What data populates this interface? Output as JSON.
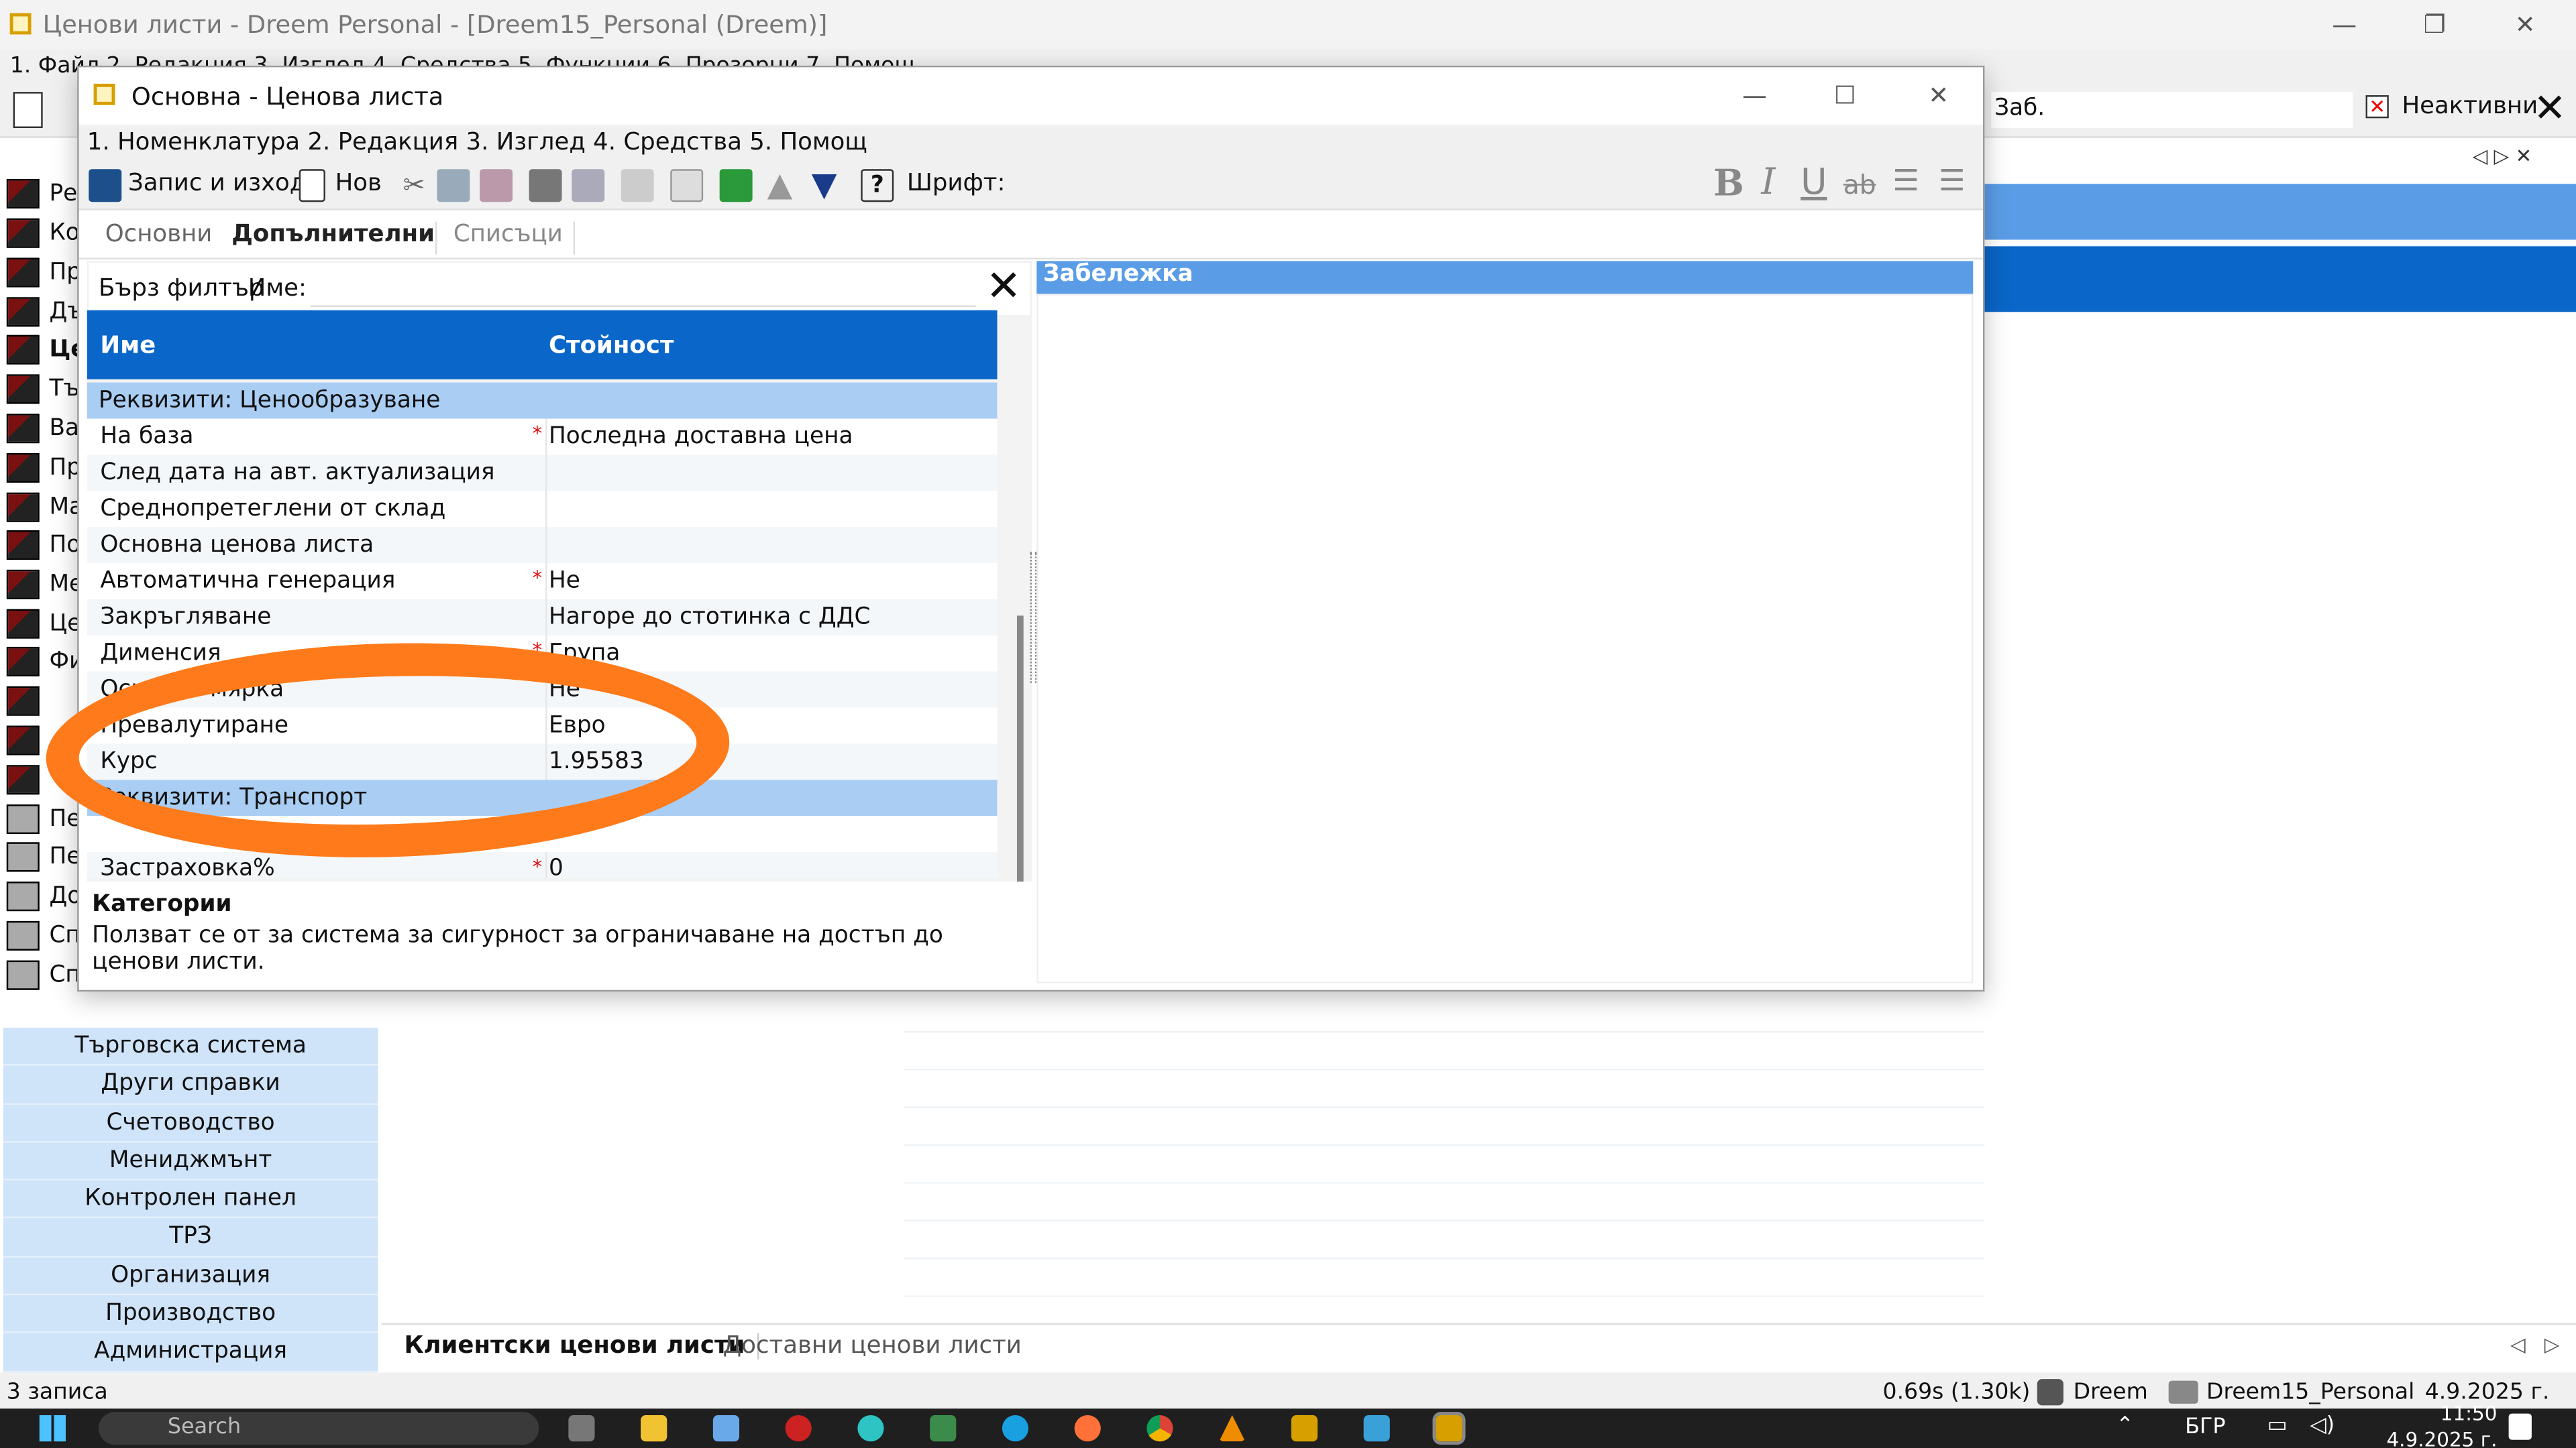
{
  "main_window": {
    "title": "Ценови листи - Dreem Personal - [Dreem15_Personal (Dreem)]",
    "menu": "1. Файл 2. Редакция 3. Изглед 4. Средства 5. Функции 6. Прозорци 7. Помощ",
    "search_label": "Заб.",
    "inactive_label": "Неактивни"
  },
  "nav_items": [
    "Ре",
    "Ко",
    "Пр",
    "Дъ",
    "Це",
    "Тъ",
    "Ва",
    "Пр",
    "Ма",
    "По",
    "Ме",
    "Це",
    "Фи",
    "",
    "",
    "",
    "Пе",
    "Пе",
    "До",
    "Сп",
    "Сп"
  ],
  "nav_groups": [
    "Търговска система",
    "Други справки",
    "Счетоводство",
    "Мениджмънт",
    "Контролен панел",
    "ТРЗ",
    "Организация",
    "Производство",
    "Администрация"
  ],
  "bottom_tabs": [
    "Клиентски ценови листи",
    "Доставни ценови листи"
  ],
  "status": {
    "records": "3 записа",
    "timing": "0.69s (1.30k)",
    "user": "Dreem",
    "database": "Dreem15_Personal",
    "date": "4.9.2025 г."
  },
  "taskbar": {
    "search": "Search",
    "language": "БГР",
    "clock_time": "11:50",
    "clock_date": "4.9.2025 г."
  },
  "dialog": {
    "title": "Основна - Ценова листа",
    "menu": "1. Номенклатура 2. Редакция 3. Изглед 4. Средства 5. Помощ",
    "toolbar": {
      "save_exit": "Запис и изход",
      "new": "Нов",
      "font_label": "Шрифт:"
    },
    "tabs": [
      "Основни",
      "Допълнителни",
      "Списъци"
    ],
    "filter": {
      "label": "Бърз филтър",
      "name_label": "Име:"
    },
    "grid": {
      "col_name": "Име",
      "col_value": "Стойност"
    },
    "group1": "Реквизити: Ценообразуване",
    "rows": [
      {
        "name": "На база",
        "value": "Последна доставна цена",
        "required": "*"
      },
      {
        "name": "След дата на авт. актуализация",
        "value": "",
        "required": ""
      },
      {
        "name": "Среднопретеглени от склад",
        "value": "",
        "required": ""
      },
      {
        "name": "Основна ценова листа",
        "value": "",
        "required": ""
      },
      {
        "name": "Автоматична генерация",
        "value": "Не",
        "required": "*"
      },
      {
        "name": "Закръгляване",
        "value": "Нагоре до стотинка с ДДС",
        "required": ""
      },
      {
        "name": "Дименсия",
        "value": "Група",
        "required": "*"
      },
      {
        "name": "Основна мярка",
        "value": "Не",
        "required": ""
      },
      {
        "name": "Превалутиране",
        "value": "Евро",
        "required": ""
      },
      {
        "name": "Курс",
        "value": "1.95583",
        "required": ""
      }
    ],
    "group2": "Реквизити: Транспорт",
    "partial_row": {
      "name": "Застраховка%",
      "value": "0",
      "required": "*"
    },
    "note_header": "Забележка",
    "description": {
      "title": "Категории",
      "text": "Ползват се от за система за сигурност за ограничаване на достъп до ценови листи."
    }
  },
  "annotation_color": "#ff7a1a"
}
